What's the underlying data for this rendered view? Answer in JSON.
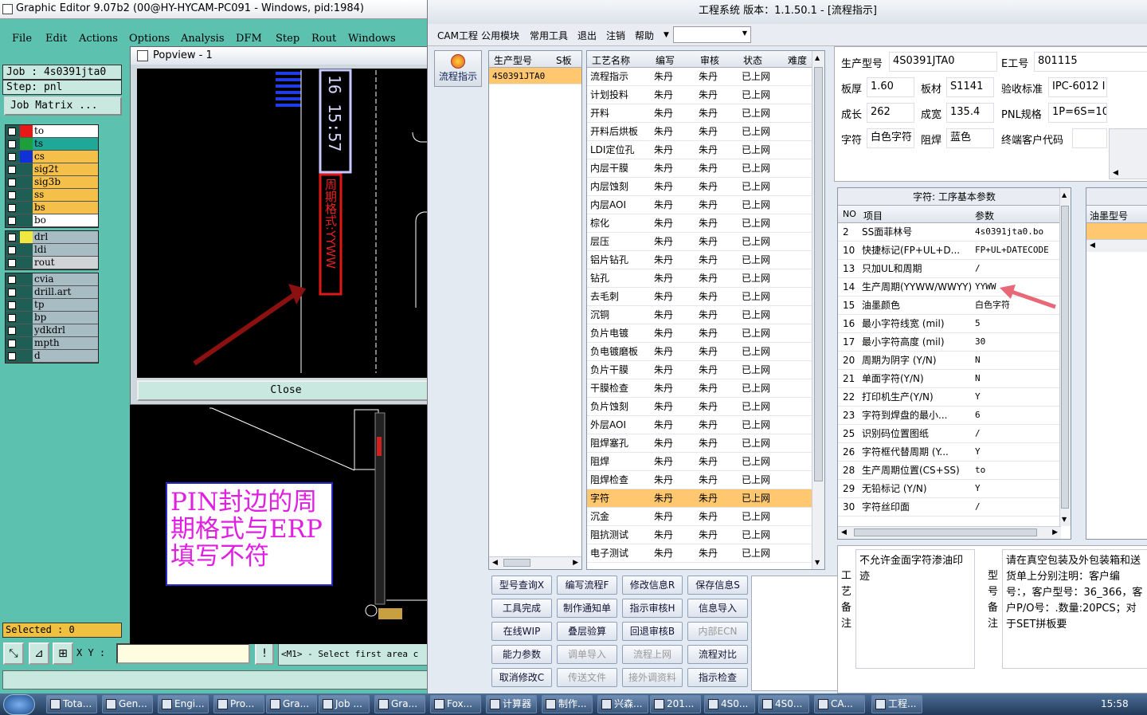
{
  "graphic_editor": {
    "title": "Graphic Editor 9.07b2 (00@HY-HYCAM-PC091 - Windows, pid:1984)",
    "menu": [
      "File",
      "Edit",
      "Actions",
      "Options",
      "Analysis",
      "DFM",
      "Step",
      "Rout",
      "Windows"
    ],
    "job": "Job : 4s0391jta0",
    "step": "Step: pnl",
    "job_matrix": "Job Matrix ...",
    "layers_group1": [
      {
        "name": "to",
        "color": "#ffffff",
        "swatch": "#e81818"
      },
      {
        "name": "ts",
        "color": "#1fa898",
        "swatch": "#1e9e3a"
      },
      {
        "name": "cs",
        "color": "#f4c04a",
        "swatch": "#1030d8"
      },
      {
        "name": "sig2t",
        "color": "#f4c04a",
        "swatch": "#1f5e55"
      },
      {
        "name": "sig3b",
        "color": "#f4c04a",
        "swatch": "#1f5e55"
      },
      {
        "name": "ss",
        "color": "#f4c04a",
        "swatch": "#1f5e55"
      },
      {
        "name": "bs",
        "color": "#f4c04a",
        "swatch": "#1f5e55"
      },
      {
        "name": "bo",
        "color": "#ffffff",
        "swatch": "#1f5e55"
      }
    ],
    "layers_group2": [
      {
        "name": "drl",
        "color": "#a8bcc4",
        "swatch": "#f0e840"
      },
      {
        "name": "ldi",
        "color": "#a8bcc4",
        "swatch": "#1f5e55"
      },
      {
        "name": "rout",
        "color": "#d0d4d6",
        "swatch": "#1f5e55"
      }
    ],
    "layers_group3": [
      {
        "name": "cvia",
        "color": "#a8bcc4"
      },
      {
        "name": "drill.art",
        "color": "#a8bcc4"
      },
      {
        "name": "tp",
        "color": "#a8bcc4"
      },
      {
        "name": "bp",
        "color": "#a8bcc4"
      },
      {
        "name": "ydkdrl",
        "color": "#a8bcc4"
      },
      {
        "name": "mpth",
        "color": "#a8bcc4"
      },
      {
        "name": "d",
        "color": "#a8bcc4"
      }
    ],
    "selected": "Selected : 0",
    "xy_label": "X Y :",
    "message": "<M1> - Select first area c",
    "popview": {
      "title": "Popview - 1",
      "close": "Close",
      "date_text": "16 15:57",
      "red_text": "周期格式:YYWW"
    },
    "note": "PIN封边的周期格式与ERP填写不符"
  },
  "erp": {
    "title": "工程系统   版本：1.1.50.1 - [流程指示]",
    "menu": [
      "CAM工程",
      "公用模块",
      "常用工具",
      "退出",
      "注销",
      "帮助"
    ],
    "left_button": "流程指示",
    "model_grid": {
      "headers": [
        "生产型号",
        "S板"
      ],
      "rows": [
        [
          "4S0391JTA0",
          ""
        ]
      ]
    },
    "process_grid": {
      "headers": [
        "工艺名称",
        "编写",
        "审核",
        "状态",
        "难度"
      ],
      "rows": [
        [
          "流程指示",
          "朱丹",
          "朱丹",
          "已上网"
        ],
        [
          "计划投料",
          "朱丹",
          "朱丹",
          "已上网"
        ],
        [
          "开料",
          "朱丹",
          "朱丹",
          "已上网"
        ],
        [
          "开料后烘板",
          "朱丹",
          "朱丹",
          "已上网"
        ],
        [
          "LDI定位孔",
          "朱丹",
          "朱丹",
          "已上网"
        ],
        [
          "内层干膜",
          "朱丹",
          "朱丹",
          "已上网"
        ],
        [
          "内层蚀刻",
          "朱丹",
          "朱丹",
          "已上网"
        ],
        [
          "内层AOI",
          "朱丹",
          "朱丹",
          "已上网"
        ],
        [
          "棕化",
          "朱丹",
          "朱丹",
          "已上网"
        ],
        [
          "层压",
          "朱丹",
          "朱丹",
          "已上网"
        ],
        [
          "铝片钻孔",
          "朱丹",
          "朱丹",
          "已上网"
        ],
        [
          "钻孔",
          "朱丹",
          "朱丹",
          "已上网"
        ],
        [
          "去毛刺",
          "朱丹",
          "朱丹",
          "已上网"
        ],
        [
          "沉铜",
          "朱丹",
          "朱丹",
          "已上网"
        ],
        [
          "负片电镀",
          "朱丹",
          "朱丹",
          "已上网"
        ],
        [
          "负电镀磨板",
          "朱丹",
          "朱丹",
          "已上网"
        ],
        [
          "负片干膜",
          "朱丹",
          "朱丹",
          "已上网"
        ],
        [
          "干膜检查",
          "朱丹",
          "朱丹",
          "已上网"
        ],
        [
          "负片蚀刻",
          "朱丹",
          "朱丹",
          "已上网"
        ],
        [
          "外层AOI",
          "朱丹",
          "朱丹",
          "已上网"
        ],
        [
          "阻焊塞孔",
          "朱丹",
          "朱丹",
          "已上网"
        ],
        [
          "阻焊",
          "朱丹",
          "朱丹",
          "已上网"
        ],
        [
          "阻焊检查",
          "朱丹",
          "朱丹",
          "已上网"
        ],
        [
          "字符",
          "朱丹",
          "朱丹",
          "已上网"
        ],
        [
          "沉金",
          "朱丹",
          "朱丹",
          "已上网"
        ],
        [
          "阻抗测试",
          "朱丹",
          "朱丹",
          "已上网"
        ],
        [
          "电子测试",
          "朱丹",
          "朱丹",
          "已上网"
        ]
      ],
      "selected_index": 23
    },
    "buttons": [
      [
        "型号查询X",
        "编写流程F",
        "修改信息R",
        "保存信息S"
      ],
      [
        "工具完成",
        "制作通知单",
        "指示审核H",
        "信息导入"
      ],
      [
        "在线WIP",
        "叠层验算",
        "回退审核B",
        "内部ECN"
      ],
      [
        "能力参数",
        "调单导入",
        "流程上网",
        "流程对比"
      ],
      [
        "取消修改C",
        "传送文件",
        "接外调资料",
        "指示检查"
      ]
    ],
    "disabled_buttons": [
      "内部ECN",
      "调单导入",
      "流程上网",
      "传送文件",
      "接外调资料"
    ],
    "info": {
      "prod_model_label": "生产型号",
      "prod_model": "4S0391JTA0",
      "eng_label": "E工号",
      "eng": "801115",
      "thickness_label": "板厚",
      "thickness": "1.60",
      "material_label": "板材",
      "material": "S1141",
      "standard_label": "验收标准",
      "standard": "IPC-6012 I",
      "length_label": "成长",
      "length": "262",
      "width_label": "成宽",
      "width": "135.4",
      "pnl_label": "PNL规格",
      "pnl": "1P=6S=10",
      "char_label": "字符",
      "char": "白色字符",
      "mask_label": "阻焊",
      "mask": "蓝色",
      "customer_label": "终端客户代码",
      "customer": ""
    },
    "param_grid": {
      "title": "字符: 工序基本参数",
      "headers": [
        "NO",
        "项目",
        "参数"
      ],
      "rows": [
        [
          "2",
          "SS面菲林号",
          "4s0391jta0.bo"
        ],
        [
          "10",
          "快捷标记(FP+UL+D...",
          "FP+UL+DATECODE"
        ],
        [
          "13",
          "只加UL和周期",
          "/"
        ],
        [
          "14",
          "生产周期(YYWW/WWYY)",
          "YYWW"
        ],
        [
          "15",
          "油墨颜色",
          "白色字符"
        ],
        [
          "16",
          "最小字符线宽 (mil)",
          "5"
        ],
        [
          "17",
          "最小字符高度 (mil)",
          "30"
        ],
        [
          "20",
          "周期为阴字 (Y/N)",
          "N"
        ],
        [
          "21",
          "单面字符(Y/N)",
          "N"
        ],
        [
          "22",
          "打印机生产(Y/N)",
          "Y"
        ],
        [
          "23",
          "字符到焊盘的最小...",
          "6"
        ],
        [
          "25",
          "识别码位置图纸",
          "/"
        ],
        [
          "26",
          "字符框代替周期 (Y...",
          "Y"
        ],
        [
          "28",
          "生产周期位置(CS+SS)",
          "to"
        ],
        [
          "29",
          "无铅标记 (Y/N)",
          "Y"
        ],
        [
          "30",
          "字符丝印面",
          "/"
        ]
      ]
    },
    "ink_header": "油墨型号",
    "remark_label": "工艺备注",
    "remark_text": "不允许金面字符渗油印迹",
    "model_remark_label": "型号备注",
    "model_remark_text": "请在真空包装及外包装箱和送货单上分别注明：客户编号：，客户型号：36_366，客户P/O号：.数量:20PCS；对于SET拼板要"
  },
  "taskbar": {
    "items": [
      "Tota...",
      "Gen...",
      "Engi...",
      "Pro...",
      "Gra...",
      "Job ...",
      "Gra...",
      "Fox...",
      "计算器",
      "制作...",
      "兴森...",
      "201...",
      "4S0...",
      "4S0...",
      "CA...",
      "工程..."
    ],
    "clock": "15:58"
  }
}
